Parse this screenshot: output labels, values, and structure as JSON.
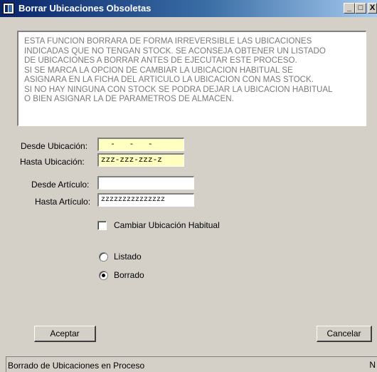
{
  "window": {
    "title": "Borrar Ubicaciones Obsoletas",
    "minimize_glyph": "_",
    "maximize_glyph": "□",
    "close_glyph": "X"
  },
  "info_lines": [
    "ESTA FUNCION BORRARA DE FORMA IRREVERSIBLE LAS UBICACIONES",
    "INDICADAS QUE NO TENGAN STOCK. SE ACONSEJA OBTENER UN LISTADO",
    "DE UBICACIONES A BORRAR  ANTES DE EJECUTAR ESTE PROCESO.",
    "SI SE MARCA LA OPCION DE CAMBIAR LA UBICACION HABITUAL SE",
    "ASIGNARA EN LA FICHA DEL ARTICULO LA UBICACION CON MAS STOCK.",
    "SI NO HAY NINGUNA CON STOCK SE PODRA DEJAR LA UBICACION HABITUAL",
    "O BIEN ASIGNAR LA DE PARAMETROS DE ALMACEN."
  ],
  "form": {
    "desde_ubicacion": {
      "label": "Desde Ubicación:",
      "value": "  -   -   -  "
    },
    "hasta_ubicacion": {
      "label": "Hasta Ubicación:",
      "value": "zzz-zzz-zzz-z"
    },
    "desde_articulo": {
      "label": "Desde Artículo:",
      "value": ""
    },
    "hasta_articulo": {
      "label": "Hasta Artículo:",
      "value": "zzzzzzzzzzzzzzz"
    },
    "cambiar_ubicacion": {
      "label": "Cambiar Ubicación Habitual",
      "checked": false
    },
    "options": [
      {
        "label": "Listado",
        "selected": false
      },
      {
        "label": "Borrado",
        "selected": true
      }
    ]
  },
  "buttons": {
    "accept": "Aceptar",
    "cancel": "Cancelar"
  },
  "status": {
    "text": "Borrado de Ubicaciones en Proceso",
    "corner": "N"
  },
  "colors": {
    "title_start": "#0a246a",
    "title_end": "#a6caf0",
    "face": "#d4d0c8",
    "highlight_field": "#ffffc0",
    "info_text": "#7a7a7a"
  }
}
